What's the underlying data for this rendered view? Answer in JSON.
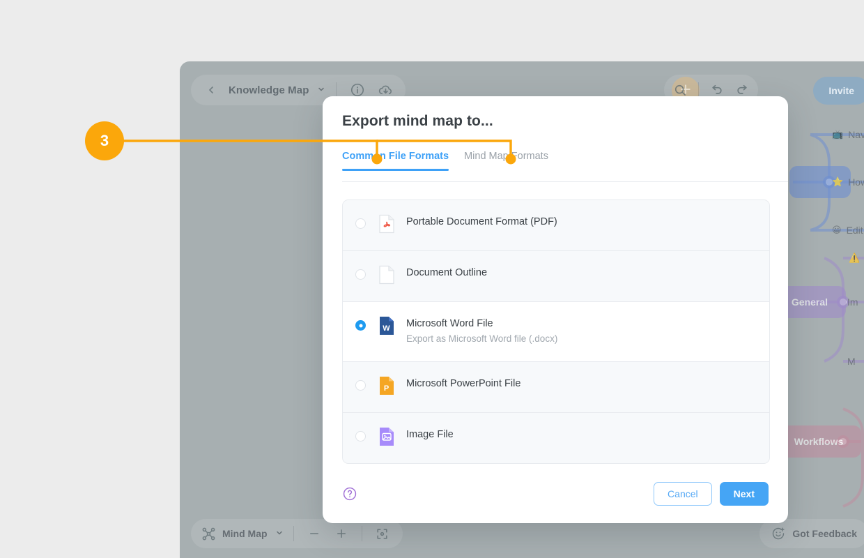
{
  "annotation": {
    "step_number": "3",
    "accent_color": "#fba70b"
  },
  "app": {
    "toolbar": {
      "back_icon": "chevron-left-icon",
      "title": "Knowledge Map",
      "title_chevron": "chevron-down-icon",
      "info_icon": "info-icon",
      "cloud_upload_icon": "cloud-upload-icon",
      "add_icon": "plus-icon",
      "search_icon": "search-icon",
      "undo_icon": "undo-icon",
      "redo_icon": "redo-icon",
      "invite_label": "Invite"
    },
    "bottom_bar": {
      "mode_icon": "mind-map-icon",
      "mode_label": "Mind Map",
      "mode_chevron": "chevron-down-icon",
      "zoom_out_icon": "minus-icon",
      "zoom_in_icon": "plus-icon",
      "fit_icon": "fit-to-screen-icon",
      "feedback_icon": "smiley-plus-icon",
      "feedback_label": "Got Feedback"
    },
    "mind_map": {
      "nodes": [
        {
          "label": "General",
          "color": "#9f94c9"
        },
        {
          "label": "Workflows",
          "color": "#bf8ea0"
        }
      ],
      "leaves": [
        {
          "emoji": "📺",
          "label": "Nav"
        },
        {
          "emoji": "⭐",
          "label": "How"
        },
        {
          "emoji": "😀",
          "label": "Edit"
        },
        {
          "emoji": "⚠️",
          "label": ""
        },
        {
          "emoji": "",
          "label": "Im"
        },
        {
          "emoji": "",
          "label": "M"
        }
      ]
    }
  },
  "modal": {
    "title": "Export mind map to...",
    "tabs": [
      {
        "label": "Common File Formats",
        "active": true
      },
      {
        "label": "Mind Map Formats",
        "active": false
      }
    ],
    "formats": [
      {
        "title": "Portable Document Format (PDF)",
        "subtitle": "",
        "icon": "pdf-file-icon",
        "selected": false
      },
      {
        "title": "Document Outline",
        "subtitle": "",
        "icon": "blank-document-icon",
        "selected": false
      },
      {
        "title": "Microsoft Word File",
        "subtitle": "Export as Microsoft Word file (.docx)",
        "icon": "word-file-icon",
        "selected": true
      },
      {
        "title": "Microsoft PowerPoint File",
        "subtitle": "",
        "icon": "powerpoint-file-icon",
        "selected": false
      },
      {
        "title": "Image File",
        "subtitle": "",
        "icon": "image-file-icon",
        "selected": false
      }
    ],
    "footer": {
      "help_icon": "help-circle-icon",
      "cancel_label": "Cancel",
      "next_label": "Next"
    },
    "colors": {
      "active_tab": "#3ea1f7",
      "primary_button": "#45a5f5",
      "radio_on": "#1e9bf0"
    }
  }
}
